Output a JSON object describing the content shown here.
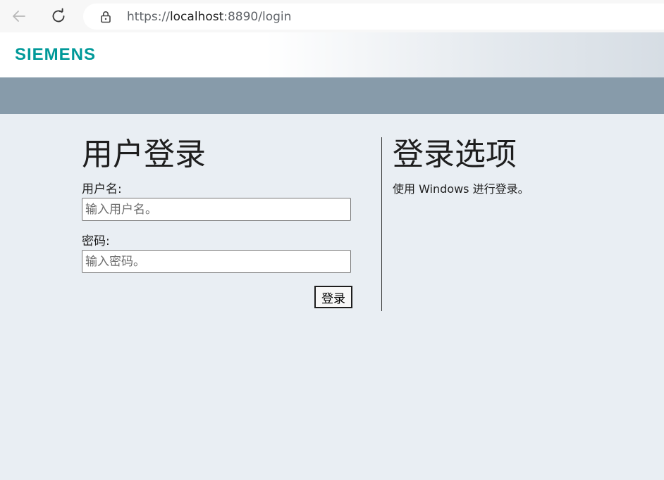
{
  "browser": {
    "url_prefix": "https://",
    "url_host": "localhost",
    "url_rest": ":8890/login",
    "back_icon": "arrow-left-icon",
    "reload_icon": "reload-icon",
    "lock_icon": "lock-icon"
  },
  "header": {
    "brand": "SIEMENS",
    "brand_color": "#009999",
    "band_color": "#879baa"
  },
  "login": {
    "title": "用户登录",
    "username_label": "用户名:",
    "username_placeholder": "输入用户名。",
    "username_value": "",
    "password_label": "密码:",
    "password_placeholder": "输入密码。",
    "password_value": "",
    "submit_label": "登录"
  },
  "options": {
    "title": "登录选项",
    "windows_text": "使用 Windows 进行登录。"
  }
}
